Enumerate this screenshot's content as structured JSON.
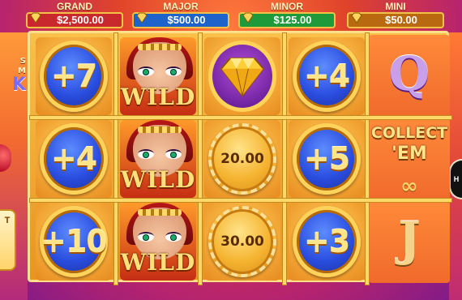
{
  "jackpots": [
    {
      "name": "GRAND",
      "value": "$2,500.00",
      "color": "#c9292d"
    },
    {
      "name": "MAJOR",
      "value": "$500.00",
      "color": "#1e63c9"
    },
    {
      "name": "MINOR",
      "value": "$125.00",
      "color": "#1e9a3a"
    },
    {
      "name": "MINI",
      "value": "$50.00",
      "color": "#b96a10"
    }
  ],
  "reels": {
    "col1": [
      "+7",
      "+4",
      "+10"
    ],
    "col2": [
      "WILD",
      "WILD",
      "WILD"
    ],
    "col3": {
      "top": "diamond-icon",
      "mid": "20.00",
      "bot": "30.00"
    },
    "col4": [
      "+4",
      "+5",
      "+3"
    ],
    "col5": {
      "top": "Q",
      "mid_line1": "COLLECT",
      "mid_line2": "'EM",
      "bot": "J",
      "infinity": "∞"
    }
  },
  "left_logo": {
    "line1": "S",
    "line2": "M",
    "big": "K"
  },
  "colors": {
    "reel_frame": "#ffe08a",
    "blue_coin": "#2a4ddf",
    "gold_coin": "#f5b431",
    "background": "#e0442a"
  }
}
